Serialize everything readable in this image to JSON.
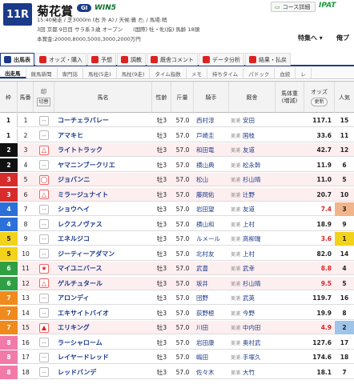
{
  "header": {
    "race_no": "11R",
    "race_name": "菊花賞",
    "grade": "GI",
    "win5": "WIN5",
    "course_btn": "コース詳細",
    "ipat": "IPAT",
    "line1": "15:40発走 / 芝3000m (右 外 A) / 天候:曇 🌥 / 馬場:稍",
    "line2": "3回 京都 9日目 サラ系３歳 オープン　　(国際) 牡・牝(指) 馬齢 18頭",
    "line3": "本賞金:20000,8000,5000,3000,2000万円",
    "feature": "特集へ ▾",
    "ore": "俺プ"
  },
  "tabs": [
    {
      "label": "出馬表",
      "icon": "table-icon",
      "color": "#1b3a8a"
    },
    {
      "label": "オッズ・購入",
      "icon": "odds-icon",
      "color": "#d22"
    },
    {
      "label": "予想",
      "icon": "target-icon",
      "color": "#d22"
    },
    {
      "label": "調教",
      "icon": "training-icon",
      "color": "#d22"
    },
    {
      "label": "厩舎コメント",
      "icon": "comment-icon",
      "color": "#d22"
    },
    {
      "label": "データ分析",
      "icon": "data-icon",
      "color": "#d22"
    },
    {
      "label": "結果・払戻",
      "icon": "result-icon",
      "color": "#d22"
    }
  ],
  "subtabs": [
    "出走馬",
    "競馬新聞",
    "専門誌",
    "馬柱(5走)",
    "馬柱(9走)",
    "タイム指数",
    "メモ",
    "持ちタイム",
    "パドック",
    "血統",
    "レ"
  ],
  "columns": {
    "waku": "枠",
    "umaban": "馬番",
    "mark": "印",
    "kiri": "切替",
    "horse": "馬名",
    "sex_age": "性齢",
    "weight": "斤量",
    "jockey": "騎手",
    "trainer": "厩舎",
    "body_weight": "馬体重",
    "body_weight_sub": "(増減)",
    "odds": "オッズ",
    "odds_btn": "更新",
    "pop": "人気"
  },
  "rows": [
    {
      "waku": "1",
      "uma": "1",
      "mark": "--",
      "horse": "コーチェラバレー",
      "sa": "牡3",
      "w": "57.0",
      "jockey": "西村淳",
      "loc": "美浦",
      "trainer": "安田",
      "odds": "117.1",
      "pop": "15",
      "red": false
    },
    {
      "waku": "1",
      "uma": "2",
      "mark": "--",
      "horse": "アマキヒ",
      "sa": "牡3",
      "w": "57.0",
      "jockey": "戸崎圭",
      "loc": "美浦",
      "trainer": "国枝",
      "odds": "33.6",
      "pop": "11",
      "red": false
    },
    {
      "waku": "2",
      "uma": "3",
      "mark": "△",
      "horse": "ライトトラック",
      "sa": "牡3",
      "w": "57.0",
      "jockey": "和田竜",
      "loc": "美浦",
      "trainer": "友道",
      "odds": "42.7",
      "pop": "12",
      "red": false
    },
    {
      "waku": "2",
      "uma": "4",
      "mark": "--",
      "horse": "ヤマニンブークリエ",
      "sa": "牡3",
      "w": "57.0",
      "jockey": "横山典",
      "loc": "美浦",
      "trainer": "松永幹",
      "odds": "11.9",
      "pop": "6",
      "red": false
    },
    {
      "waku": "3",
      "uma": "5",
      "mark": "◯",
      "horse": "ジョバンニ",
      "sa": "牡3",
      "w": "57.0",
      "jockey": "松山",
      "loc": "美浦",
      "trainer": "杉山晴",
      "odds": "11.0",
      "pop": "5",
      "red": false
    },
    {
      "waku": "3",
      "uma": "6",
      "mark": "△",
      "horse": "ミラージュナイト",
      "sa": "牡3",
      "w": "57.0",
      "jockey": "藤岡佑",
      "loc": "美浦",
      "trainer": "辻野",
      "odds": "20.7",
      "pop": "10",
      "red": false
    },
    {
      "waku": "4",
      "uma": "7",
      "mark": "--",
      "horse": "ショウヘイ",
      "sa": "牡3",
      "w": "57.0",
      "jockey": "岩田望",
      "loc": "美浦",
      "trainer": "友道",
      "odds": "7.4",
      "pop": "3",
      "red": true
    },
    {
      "waku": "4",
      "uma": "8",
      "mark": "--",
      "horse": "レクスノヴァス",
      "sa": "牡3",
      "w": "57.0",
      "jockey": "横山和",
      "loc": "美浦",
      "trainer": "上村",
      "odds": "18.9",
      "pop": "9",
      "red": false
    },
    {
      "waku": "5",
      "uma": "9",
      "mark": "--",
      "horse": "エネルジコ",
      "sa": "牡3",
      "w": "57.0",
      "jockey": "ルメール",
      "loc": "美浦",
      "trainer": "高柳瑞",
      "odds": "3.6",
      "pop": "1",
      "red": true
    },
    {
      "waku": "5",
      "uma": "10",
      "mark": "--",
      "horse": "ジーティーアダマン",
      "sa": "牡3",
      "w": "57.0",
      "jockey": "北村友",
      "loc": "美浦",
      "trainer": "上村",
      "odds": "82.0",
      "pop": "14",
      "red": false
    },
    {
      "waku": "6",
      "uma": "11",
      "mark": "★",
      "horse": "マイユニバース",
      "sa": "牡3",
      "w": "57.0",
      "jockey": "武豊",
      "loc": "美浦",
      "trainer": "武幸",
      "odds": "8.8",
      "pop": "4",
      "red": true
    },
    {
      "waku": "6",
      "uma": "12",
      "mark": "△",
      "horse": "ゲルチュタール",
      "sa": "牡3",
      "w": "57.0",
      "jockey": "坂井",
      "loc": "美浦",
      "trainer": "杉山晴",
      "odds": "9.5",
      "pop": "5",
      "red": true
    },
    {
      "waku": "7",
      "uma": "13",
      "mark": "--",
      "horse": "アロンディ",
      "sa": "牡3",
      "w": "57.0",
      "jockey": "団野",
      "loc": "美浦",
      "trainer": "武英",
      "odds": "119.7",
      "pop": "16",
      "red": false
    },
    {
      "waku": "7",
      "uma": "14",
      "mark": "--",
      "horse": "エキサイトバイオ",
      "sa": "牡3",
      "w": "57.0",
      "jockey": "荻野極",
      "loc": "美浦",
      "trainer": "今野",
      "odds": "19.9",
      "pop": "8",
      "red": false
    },
    {
      "waku": "7",
      "uma": "15",
      "mark": "▲",
      "horse": "エリキング",
      "sa": "牡3",
      "w": "57.0",
      "jockey": "川田",
      "loc": "美浦",
      "trainer": "中内田",
      "odds": "4.9",
      "pop": "2",
      "red": true
    },
    {
      "waku": "8",
      "uma": "16",
      "mark": "--",
      "horse": "ラーシャローム",
      "sa": "牡3",
      "w": "57.0",
      "jockey": "岩田康",
      "loc": "美浦",
      "trainer": "奥村武",
      "odds": "127.6",
      "pop": "17",
      "red": false
    },
    {
      "waku": "8",
      "uma": "17",
      "mark": "--",
      "horse": "レイヤードレッド",
      "sa": "牡3",
      "w": "57.0",
      "jockey": "嶋田",
      "loc": "美浦",
      "trainer": "手塚久",
      "odds": "174.6",
      "pop": "18",
      "red": false
    },
    {
      "waku": "8",
      "uma": "18",
      "mark": "--",
      "horse": "レッドバンデ",
      "sa": "牡3",
      "w": "57.0",
      "jockey": "佐々木",
      "loc": "美浦",
      "trainer": "大竹",
      "odds": "18.1",
      "pop": "7",
      "red": false
    }
  ],
  "waku_colors": {
    "1": {
      "bg": "#ffffff",
      "fg": "#222222"
    },
    "2": {
      "bg": "#111111",
      "fg": "#ffffff"
    },
    "3": {
      "bg": "#d82b2b",
      "fg": "#ffffff"
    },
    "4": {
      "bg": "#2b6fd8",
      "fg": "#ffffff"
    },
    "5": {
      "bg": "#f2d21b",
      "fg": "#222222"
    },
    "6": {
      "bg": "#2ea043",
      "fg": "#ffffff"
    },
    "7": {
      "bg": "#f08a1c",
      "fg": "#ffffff"
    },
    "8": {
      "bg": "#f27aa8",
      "fg": "#ffffff"
    }
  },
  "pop_colors": {
    "1": "#f2d21b",
    "2": "#9fc4ea",
    "3": "#f2b48a"
  }
}
